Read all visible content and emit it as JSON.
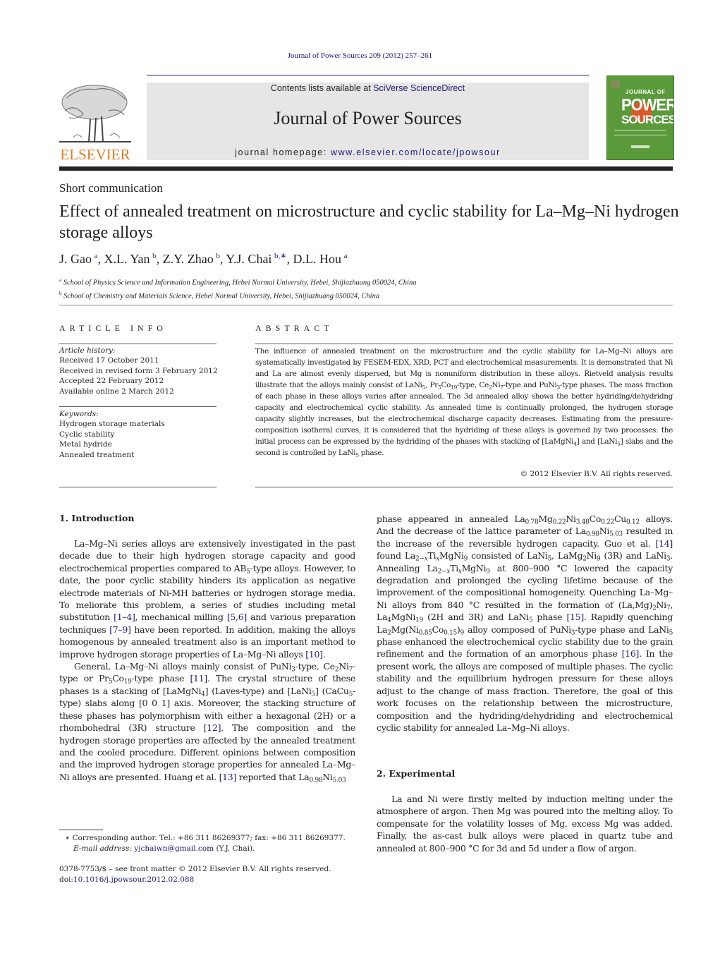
{
  "header": {
    "running_head": "Journal of Power Sources 209 (2012) 257–261",
    "contents_prefix": "Contents lists available at ",
    "contents_link": "SciVerse ScienceDirect",
    "journal_title": "Journal of Power Sources",
    "homepage_prefix": "journal homepage: ",
    "homepage_link": "www.elsevier.com/locate/jpowsour",
    "publisher_logo_text": "ELSEVIER",
    "cover": {
      "top": "JOURNAL OF",
      "line1": "POWER",
      "line2": "SOURCES",
      "background": "#5a9a3a",
      "accent": "#d9592a"
    },
    "colors": {
      "link": "#1a1a7a",
      "elsevier_orange": "#e37a1e",
      "banner_gray": "#e6e6e6"
    }
  },
  "article": {
    "type": "Short communication",
    "title": "Effect of annealed treatment on microstructure and cyclic stability for La–Mg–Ni hydrogen storage alloys",
    "authors": [
      {
        "name": "J. Gao",
        "sup": "a"
      },
      {
        "name": "X.L. Yan",
        "sup": "b"
      },
      {
        "name": "Z.Y. Zhao",
        "sup": "b"
      },
      {
        "name": "Y.J. Chai",
        "sup": "b,∗"
      },
      {
        "name": "D.L. Hou",
        "sup": "a"
      }
    ],
    "affiliations": [
      {
        "sup": "a",
        "text": "School of Physics Science and Information Engineering, Hebei Normal University, Hebei, Shijiazhuang 050024, China"
      },
      {
        "sup": "b",
        "text": "School of Chemistry and Materials Science, Hebei Normal University, Hebei, Shijiazhuang 050024, China"
      }
    ]
  },
  "article_info": {
    "heading": "ARTICLE INFO",
    "history_label": "Article history:",
    "history": [
      "Received 17 October 2011",
      "Received in revised form 3 February 2012",
      "Accepted 22 February 2012",
      "Available online 2 March 2012"
    ],
    "keywords_label": "Keywords:",
    "keywords": [
      "Hydrogen storage materials",
      "Cyclic stability",
      "Metal hydride",
      "Annealed treatment"
    ]
  },
  "abstract": {
    "heading": "ABSTRACT",
    "parts": [
      "The influence of annealed treatment on the microstructure and the cyclic stability for La–Mg–Ni alloys are systematically investigated by FESEM-EDX, XRD, PCT and electrochemical measurements. It is demonstrated that Ni and La are almost evenly dispersed, but Mg is nonuniform distribution in these alloys. Rietveld analysis results illustrate that the alloys mainly consist of LaNi",
      "5",
      ", Pr",
      "5",
      "Co",
      "19",
      "-type, Ce",
      "2",
      "Ni",
      "7",
      "-type and PuNi",
      "3",
      "-type phases. The mass fraction of each phase in these alloys varies after annealed. The 3d annealed alloy shows the better hydriding/dehydridng capacity and electrochemical cyclic stability. As annealed time is continually prolonged, the hydrogen storage capacity slightly increases, but the electrochemical discharge capacity decreases. Estimating from the pressure-composition isotheral curves, it is considered that the hydriding of these alloys is governed by two processes: the initial process can be expressed by the hydriding of the phases with stacking of [LaMgNi",
      "4",
      "] and [LaNi",
      "5",
      "] slabs and the second is controlled by LaNi",
      "5",
      " phase."
    ],
    "copyright": "© 2012 Elsevier B.V. All rights reserved."
  },
  "sections": {
    "intro_heading": "1.  Introduction",
    "experimental_heading": "2.  Experimental"
  },
  "footnote": {
    "corresponding": "∗ Corresponding author. Tel.: +86 311 86269377; fax: +86 311 86269377.",
    "email_label": "E-mail address: ",
    "email": "yjchaiwn@gmail.com",
    "email_suffix": " (Y.J. Chai).",
    "front_matter": "0378-7753/$ – see front matter © 2012 Elsevier B.V. All rights reserved.",
    "doi_prefix": "doi:",
    "doi": "10.1016/j.jpowsour.2012.02.088"
  },
  "body_html": {
    "intro_p1": "La–Mg–Ni series alloys are extensively investigated in the past decade due to their high hydrogen storage capacity and good electrochemical properties compared to AB<sub>5</sub>-type alloys. However, to date, the poor cyclic stability hinders its application as negative electrode materials of Ni-MH batteries or hydrogen storage media. To meliorate this problem, a series of studies including metal substitution <span class=\"link\">[1–4]</span>, mechanical milling <span class=\"link\">[5,6]</span> and various preparation techniques <span class=\"link\">[7–9]</span> have been reported. In addition, making the alloys homogenous by annealed treatment also is an important method to improve hydrogen storage properties of La–Mg–Ni alloys <span class=\"link\">[10]</span>.",
    "intro_p2": "General, La–Mg–Ni alloys mainly consist of PuNi<sub>3</sub>-type, Ce<sub>2</sub>Ni<sub>7</sub>-type or Pr<sub>5</sub>Co<sub>19</sub>-type phase <span class=\"link\">[11]</span>. The crystal structure of these phases is a stacking of [LaMgNi<sub>4</sub>] (Laves-type) and [LaNi<sub>5</sub>] (CaCu<sub>5</sub>-type) slabs along [0 0 1] axis. Moreover, the stacking structure of these phases has polymorphism with either a hexagonal (2H) or a rhombohedral (3R) structure <span class=\"link\">[12]</span>. The composition and the hydrogen storage properties are affected by the annealed treatment and the cooled procedure. Different opinions between composition and the improved hydrogen storage properties for annealed La–Mg–Ni alloys are presented. Huang et al. <span class=\"link\">[13]</span> reported that La<sub>0.98</sub>Ni<sub>5.03</sub>",
    "intro_right": "phase appeared in annealed La<sub>0.78</sub>Mg<sub>0.22</sub>Ni<sub>3.48</sub>Co<sub>0.22</sub>Cu<sub>0.12</sub> alloys. And the decrease of the lattice parameter of La<sub>0.98</sub>Ni<sub>5.03</sub> resulted in the increase of the reversible hydrogen capacity. Guo et al. <span class=\"link\">[14]</span> found La<sub>2−<i>x</i></sub>Ti<sub><i>x</i></sub>MgNi<sub>9</sub> consisted of LaNi<sub>5</sub>, LaMg<sub>2</sub>Ni<sub>9</sub> (3R) and LaNi<sub>3</sub>. Annealing La<sub>2−<i>x</i></sub>Ti<sub><i>x</i></sub>MgNi<sub>9</sub> at 800–900 °C lowered the capacity degradation and prolonged the cycling lifetime because of the improvement of the compositional homogeneity. Quenching La–Mg–Ni alloys from 840 °C resulted in the formation of (La,Mg)<sub>2</sub>Ni<sub>7</sub>, La<sub>4</sub>MgNi<sub>19</sub> (2H and 3R) and LaNi<sub>5</sub> phase <span class=\"link\">[15]</span>. Rapidly quenching La<sub>2</sub>Mg(Ni<sub>0.85</sub>Co<sub>0.15</sub>)<sub>9</sub> alloy composed of PuNi<sub>3</sub>-type phase and LaNi<sub>5</sub> phase enhanced the electrochemical cyclic stability due to the grain refinement and the formation of an amorphous phase <span class=\"link\">[16]</span>. In the present work, the alloys are composed of multiple phases. The cyclic stability and the equilibrium hydrogen pressure for these alloys adjust to the change of mass fraction. Therefore, the goal of this work focuses on the relationship between the microstructure, composition and the hydriding/dehydriding and electrochemical cyclic stability for annealed La–Mg–Ni alloys.",
    "experimental_p1": "La and Ni were firstly melted by induction melting under the atmosphere of argon. Then Mg was poured into the melting alloy. To compensate for the volatility losses of Mg, excess Mg was added. Finally, the as-cast bulk alloys were placed in quartz tube and annealed at 800–900 °C for 3d and 5d under a flow of argon."
  }
}
